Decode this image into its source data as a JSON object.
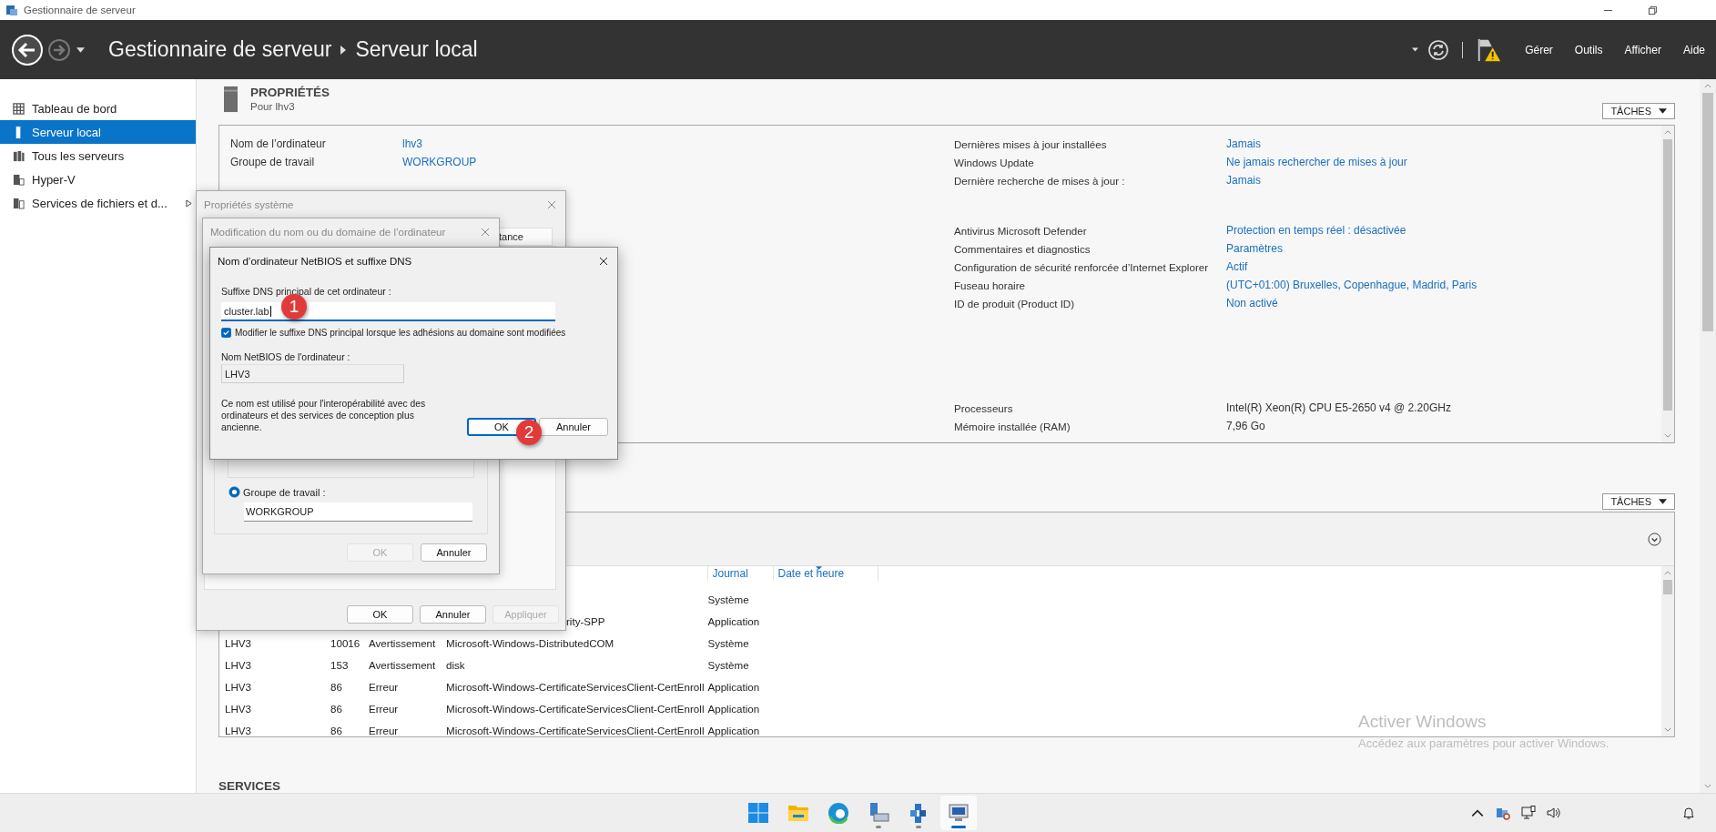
{
  "window": {
    "title": "Gestionnaire de serveur"
  },
  "header": {
    "breadcrumb": [
      "Gestionnaire de serveur",
      "Serveur local"
    ],
    "menus": [
      "Gérer",
      "Outils",
      "Afficher",
      "Aide"
    ]
  },
  "sidebar": {
    "items": [
      {
        "label": "Tableau de bord",
        "kind": "dashboard",
        "selected": false,
        "expandable": false
      },
      {
        "label": "Serveur local",
        "kind": "server",
        "selected": true,
        "expandable": false
      },
      {
        "label": "Tous les serveurs",
        "kind": "servers",
        "selected": false,
        "expandable": false
      },
      {
        "label": "Hyper-V",
        "kind": "hyperv",
        "selected": false,
        "expandable": false
      },
      {
        "label": "Services de fichiers et d...",
        "kind": "files",
        "selected": false,
        "expandable": true
      }
    ]
  },
  "properties": {
    "title": "PROPRIÉTÉS",
    "subtitle": "Pour lhv3",
    "tasks_button": "TÂCHES",
    "left": [
      {
        "label": "Nom de l’ordinateur",
        "value": "lhv3",
        "link": true
      },
      {
        "label": "Groupe de travail",
        "value": "WORKGROUP",
        "link": true
      }
    ],
    "right_groups": [
      [
        {
          "label": "Dernières mises à jour installées",
          "value": "Jamais",
          "link": true
        },
        {
          "label": "Windows Update",
          "value": "Ne jamais rechercher de mises à jour",
          "link": true
        },
        {
          "label": "Dernière recherche de mises à jour :",
          "value": "Jamais",
          "link": true
        }
      ],
      [
        {
          "label": "Antivirus Microsoft Defender",
          "value": "Protection en temps réel : désactivée",
          "link": true
        },
        {
          "label": "Commentaires et diagnostics",
          "value": "Paramètres",
          "link": true
        },
        {
          "label": "Configuration de sécurité renforcée d’Internet Explorer",
          "value": "Actif",
          "link": true
        },
        {
          "label": "Fuseau horaire",
          "value": "(UTC+01:00) Bruxelles, Copenhague, Madrid, Paris",
          "link": true
        },
        {
          "label": "ID de produit (Product ID)",
          "value": "Non activé",
          "link": true
        }
      ],
      [
        {
          "label": "Processeurs",
          "value": "Intel(R) Xeon(R) CPU E5-2650 v4 @ 2.20GHz",
          "link": false
        },
        {
          "label": "Mémoire installée (RAM)",
          "value": "7,96 Go",
          "link": false
        }
      ]
    ]
  },
  "events": {
    "tasks_button": "TÂCHES",
    "columns": [
      "Journal",
      "Date et heure"
    ],
    "rows": [
      {
        "kind": "partial",
        "journal": "Système"
      },
      {
        "kind": "partial",
        "source": "rity-SPP",
        "journal": "Application"
      },
      {
        "kind": "full",
        "server": "LHV3",
        "id": "10016",
        "level": "Avertissement",
        "source": "Microsoft-Windows-DistributedCOM",
        "journal": "Système"
      },
      {
        "kind": "full",
        "server": "LHV3",
        "id": "153",
        "level": "Avertissement",
        "source": "disk",
        "journal": "Système"
      },
      {
        "kind": "full",
        "server": "LHV3",
        "id": "86",
        "level": "Erreur",
        "source": "Microsoft-Windows-CertificateServicesClient-CertEnroll",
        "journal": "Application"
      },
      {
        "kind": "full",
        "server": "LHV3",
        "id": "86",
        "level": "Erreur",
        "source": "Microsoft-Windows-CertificateServicesClient-CertEnroll",
        "journal": "Application"
      },
      {
        "kind": "full",
        "server": "LHV3",
        "id": "86",
        "level": "Erreur",
        "source": "Microsoft-Windows-CertificateServicesClient-CertEnroll",
        "journal": "Application"
      }
    ]
  },
  "services": {
    "title": "SERVICES"
  },
  "dialogs": {
    "system": {
      "title": "Propriétés système",
      "fragment": "tance",
      "buttons": [
        {
          "label": "OK",
          "disabled": false
        },
        {
          "label": "Annuler",
          "disabled": false
        },
        {
          "label": "Appliquer",
          "disabled": true
        }
      ]
    },
    "rename": {
      "title": "Modification du nom ou du domaine de l’ordinateur",
      "workgroup_option": {
        "label": "Groupe de travail :",
        "selected": true
      },
      "workgroup_value": "WORKGROUP",
      "buttons": [
        {
          "label": "OK",
          "disabled": true
        },
        {
          "label": "Annuler",
          "disabled": false
        }
      ]
    },
    "dns": {
      "title": "Nom d’ordinateur NetBIOS et suffixe DNS",
      "suffix_label": "Suffixe DNS principal de cet ordinateur :",
      "suffix_value": "cluster.lab",
      "change_option": {
        "label": "Modifier le suffixe DNS principal lorsque les adhésions au domaine sont modifiées",
        "checked": true
      },
      "netbios_label": "Nom NetBIOS de l'ordinateur :",
      "netbios_value": "LHV3",
      "note": "Ce nom est utilisé pour l'interopérabilité avec des ordinateurs et des services de conception plus ancienne.",
      "buttons": [
        {
          "label": "OK",
          "default": true
        },
        {
          "label": "Annuler",
          "default": false
        }
      ]
    }
  },
  "callouts": [
    {
      "number": "1"
    },
    {
      "number": "2"
    }
  ],
  "activation": {
    "title": "Activer Windows",
    "message": "Accédez aux paramètres pour activer Windows."
  },
  "taskbar": {
    "apps": [
      {
        "kind": "start",
        "running": false,
        "selected": false
      },
      {
        "kind": "folder",
        "running": false,
        "selected": false
      },
      {
        "kind": "edge",
        "running": false,
        "selected": false
      },
      {
        "kind": "terminal",
        "running": true,
        "selected": false
      },
      {
        "kind": "cubes",
        "running": true,
        "selected": false
      },
      {
        "kind": "monitor",
        "running": true,
        "selected": true
      }
    ]
  }
}
